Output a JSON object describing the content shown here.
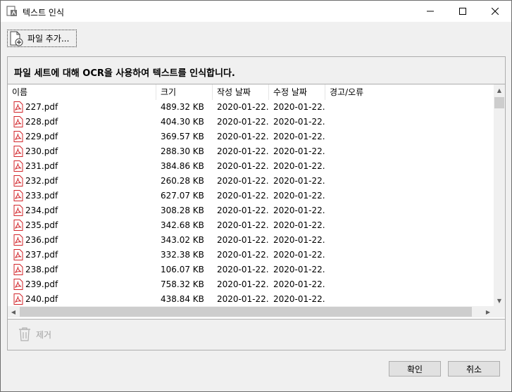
{
  "window": {
    "title": "텍스트 인식",
    "icon": "ocr-app-icon",
    "controls": {
      "minimize": "—",
      "maximize": "☐",
      "close": "✕"
    }
  },
  "toolbar": {
    "add_file_label": "파일 추가...",
    "add_file_icon": "file-add-icon"
  },
  "panel": {
    "heading": "파일 세트에 대해 OCR을 사용하여 텍스트를 인식합니다.",
    "columns": {
      "name": "이름",
      "size": "크기",
      "created": "작성 날짜",
      "modified": "수정 날짜",
      "warning": "경고/오류"
    },
    "files": [
      {
        "name": "227.pdf",
        "size": "489.32 KB",
        "created": "2020-01-22...",
        "modified": "2020-01-22..."
      },
      {
        "name": "228.pdf",
        "size": "404.30 KB",
        "created": "2020-01-22...",
        "modified": "2020-01-22..."
      },
      {
        "name": "229.pdf",
        "size": "369.57 KB",
        "created": "2020-01-22...",
        "modified": "2020-01-22..."
      },
      {
        "name": "230.pdf",
        "size": "288.30 KB",
        "created": "2020-01-22...",
        "modified": "2020-01-22..."
      },
      {
        "name": "231.pdf",
        "size": "384.86 KB",
        "created": "2020-01-22...",
        "modified": "2020-01-22..."
      },
      {
        "name": "232.pdf",
        "size": "260.28 KB",
        "created": "2020-01-22...",
        "modified": "2020-01-22..."
      },
      {
        "name": "233.pdf",
        "size": "627.07 KB",
        "created": "2020-01-22...",
        "modified": "2020-01-22..."
      },
      {
        "name": "234.pdf",
        "size": "308.28 KB",
        "created": "2020-01-22...",
        "modified": "2020-01-22..."
      },
      {
        "name": "235.pdf",
        "size": "342.68 KB",
        "created": "2020-01-22...",
        "modified": "2020-01-22..."
      },
      {
        "name": "236.pdf",
        "size": "343.02 KB",
        "created": "2020-01-22...",
        "modified": "2020-01-22..."
      },
      {
        "name": "237.pdf",
        "size": "332.38 KB",
        "created": "2020-01-22...",
        "modified": "2020-01-22..."
      },
      {
        "name": "238.pdf",
        "size": "106.07 KB",
        "created": "2020-01-22...",
        "modified": "2020-01-22..."
      },
      {
        "name": "239.pdf",
        "size": "758.32 KB",
        "created": "2020-01-22...",
        "modified": "2020-01-22..."
      },
      {
        "name": "240.pdf",
        "size": "438.84 KB",
        "created": "2020-01-22...",
        "modified": "2020-01-22..."
      }
    ],
    "remove_label": "제거",
    "remove_icon": "trash-icon",
    "pdf_icon_color": "#d2242a"
  },
  "buttons": {
    "ok": "확인",
    "cancel": "취소"
  }
}
